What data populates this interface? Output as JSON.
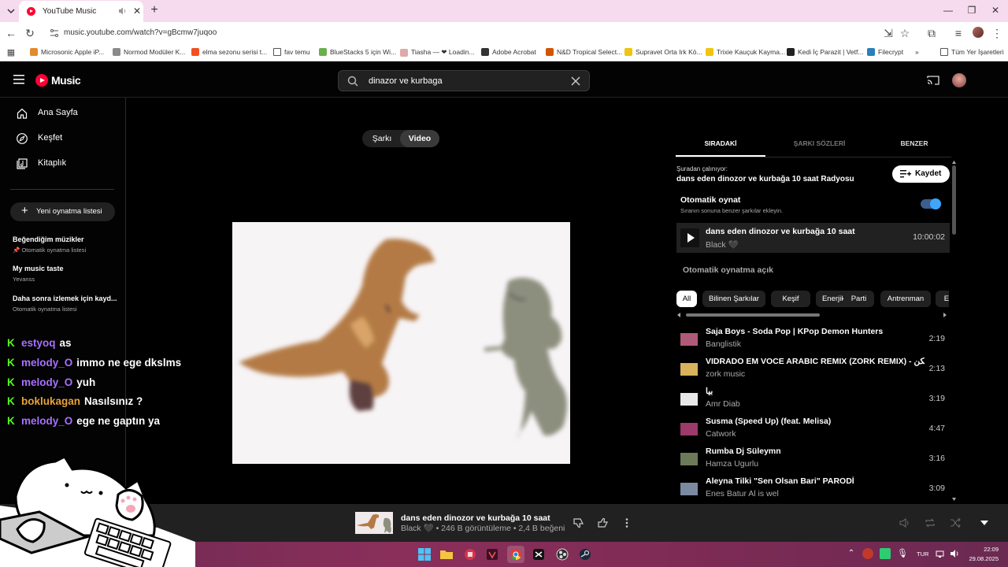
{
  "browser": {
    "tab_title": "YouTube Music",
    "url": "music.youtube.com/watch?v=gBcmw7juqoo",
    "bookmarks": [
      {
        "label": "Microsonic Apple iP...",
        "color": "#e28a2f"
      },
      {
        "label": "Normod Modüler K...",
        "color": "#8a8a8a"
      },
      {
        "label": "elma sezonu serisi t...",
        "color": "#f25022"
      },
      {
        "label": "fav temu",
        "color": "folder"
      },
      {
        "label": "BlueStacks 5 için Wi...",
        "color": "#6ab04c"
      },
      {
        "label": "Tiasha — ❤ Loadin...",
        "color": "#e0a9a9"
      },
      {
        "label": "Adobe Acrobat",
        "color": "#333333"
      },
      {
        "label": "N&D Tropical Select...",
        "color": "#d35400"
      },
      {
        "label": "Supravet Orta Irk Kö...",
        "color": "#f1c40f"
      },
      {
        "label": "Trixie Kauçuk Kayma...",
        "color": "#f1c40f"
      },
      {
        "label": "Kedi İç Parazit | Vetf...",
        "color": "#222222"
      },
      {
        "label": "Filecrypt",
        "color": "#2980b9"
      }
    ],
    "bookmarks_overflow": "»",
    "all_bookmarks": "Tüm Yer İşaretleri"
  },
  "ytm": {
    "logo_text": "Music",
    "search_query": "dinazor ve kurbaga",
    "nav": [
      {
        "label": "Ana Sayfa",
        "icon": "home-icon"
      },
      {
        "label": "Keşfet",
        "icon": "compass-icon"
      },
      {
        "label": "Kitaplık",
        "icon": "library-icon"
      }
    ],
    "new_playlist": "Yeni oynatma listesi",
    "playlists": [
      {
        "title": "Beğendiğim müzikler",
        "subtitle": "Otomatik oynatma listesi",
        "pinned": true
      },
      {
        "title": "My music taste",
        "subtitle": "Yevanss",
        "pinned": false
      },
      {
        "title": "Daha sonra izlemek için kayd...",
        "subtitle": "Otomatik oynatma listesi",
        "pinned": false
      }
    ],
    "toggle": {
      "song": "Şarkı",
      "video": "Video"
    },
    "right_tabs": [
      "SIRADAKİ",
      "ŞARKI SÖZLERİ",
      "BENZER"
    ],
    "source_label": "Şuradan çalınıyor:",
    "source_name": "dans eden dinozor ve kurbağa 10 saat Radyosu",
    "save_label": "Kaydet",
    "autoplay_title": "Otomatik oynat",
    "autoplay_sub": "Sıranın sonuna benzer şarkılar ekleyin.",
    "now_playing": {
      "title": "dans eden dinozor ve kurbağa 10 saat",
      "artist": "Black 🖤",
      "duration": "10:00:02"
    },
    "autoplay_on": "Otomatik oynatma açık",
    "chips": [
      "All",
      "Bilinen Şarkılar",
      "Keşif",
      "Enerjik",
      "Parti",
      "Antrenman",
      "El"
    ],
    "queue": [
      {
        "title": "Saja Boys - Soda Pop | KPop Demon Hunters",
        "artist": "Banglistik",
        "duration": "2:19",
        "thumb": "#b05a7a"
      },
      {
        "title": "VIDRADO EM VOCE ARABIC REMIX (ZORK REMIX) - يمكن",
        "artist": "zork music",
        "duration": "2:13",
        "thumb": "#d8b25c"
      },
      {
        "title": "بيا",
        "artist": "Amr Diab",
        "duration": "3:19",
        "thumb": "#e9e9e9"
      },
      {
        "title": "Susma (Speed Up) (feat. Melisa)",
        "artist": "Catwork",
        "duration": "4:47",
        "thumb": "#9b3a6b"
      },
      {
        "title": "Rumba Dj Süleymn",
        "artist": "Hamza Ugurlu",
        "duration": "3:16",
        "thumb": "#6d7a5a"
      },
      {
        "title": "Aleyna Tilki \"Sen Olsan Bari\" PARODİ",
        "artist": "Enes Batur Al is wel",
        "duration": "3:09",
        "thumb": "#7a8aa0"
      }
    ],
    "player": {
      "title": "dans eden dinozor ve kurbağa 10 saat",
      "subtitle": "Black 🖤 • 246 B görüntüleme • 2,4 B beğeni"
    }
  },
  "chat": [
    {
      "user": "estyoq",
      "message": "as",
      "color": "#a970ff"
    },
    {
      "user": "melody_O",
      "message": "immo ne ege dkslms",
      "color": "#a970ff"
    },
    {
      "user": "melody_O",
      "message": "yuh",
      "color": "#a970ff"
    },
    {
      "user": "boklukagan",
      "message": "Nasılsınız ?",
      "color": "#e8a23a"
    },
    {
      "user": "melody_O",
      "message": "ege ne gaptın ya",
      "color": "#a970ff"
    }
  ],
  "taskbar": {
    "language": "TUR",
    "time": "22:09",
    "date": "29.08.2025"
  }
}
